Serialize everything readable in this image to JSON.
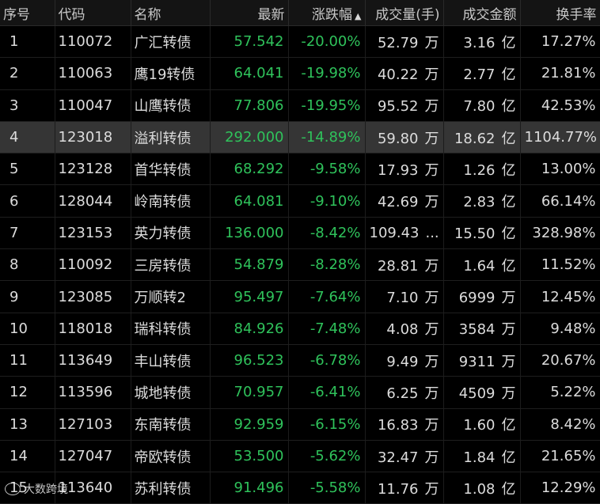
{
  "table": {
    "headers": {
      "idx": "序号",
      "code": "代码",
      "name": "名称",
      "last": "最新",
      "change": "涨跌幅",
      "change_sort_icon": "triangle-up-icon",
      "volume": "成交量(手)",
      "amount": "成交金额",
      "turnover": "换手率"
    },
    "selected_row": 4,
    "colors": {
      "down": "#2fc25b",
      "text": "#dcdcdc",
      "selected_bg": "#353535",
      "background": "#000000"
    },
    "rows": [
      {
        "idx": "1",
        "code": "110072",
        "name": "广汇转债",
        "last": "57.542",
        "change": "-20.00%",
        "volume": "52.79",
        "volume_unit": "万",
        "amount": "3.16",
        "amount_unit": "亿",
        "turnover": "17.27%"
      },
      {
        "idx": "2",
        "code": "110063",
        "name": "鹰19转债",
        "last": "64.041",
        "change": "-19.98%",
        "volume": "40.22",
        "volume_unit": "万",
        "amount": "2.77",
        "amount_unit": "亿",
        "turnover": "21.81%"
      },
      {
        "idx": "3",
        "code": "110047",
        "name": "山鹰转债",
        "last": "77.806",
        "change": "-19.95%",
        "volume": "95.52",
        "volume_unit": "万",
        "amount": "7.80",
        "amount_unit": "亿",
        "turnover": "42.53%"
      },
      {
        "idx": "4",
        "code": "123018",
        "name": "溢利转债",
        "last": "292.000",
        "change": "-14.89%",
        "volume": "59.80",
        "volume_unit": "万",
        "amount": "18.62",
        "amount_unit": "亿",
        "turnover": "1104.77%"
      },
      {
        "idx": "5",
        "code": "123128",
        "name": "首华转债",
        "last": "68.292",
        "change": "-9.58%",
        "volume": "17.93",
        "volume_unit": "万",
        "amount": "1.26",
        "amount_unit": "亿",
        "turnover": "13.00%"
      },
      {
        "idx": "6",
        "code": "128044",
        "name": "岭南转债",
        "last": "64.081",
        "change": "-9.10%",
        "volume": "42.69",
        "volume_unit": "万",
        "amount": "2.83",
        "amount_unit": "亿",
        "turnover": "66.14%"
      },
      {
        "idx": "7",
        "code": "123153",
        "name": "英力转债",
        "last": "136.000",
        "change": "-8.42%",
        "volume": "109.43",
        "volume_unit": "...",
        "amount": "15.50",
        "amount_unit": "亿",
        "turnover": "328.98%"
      },
      {
        "idx": "8",
        "code": "110092",
        "name": "三房转债",
        "last": "54.879",
        "change": "-8.28%",
        "volume": "28.81",
        "volume_unit": "万",
        "amount": "1.64",
        "amount_unit": "亿",
        "turnover": "11.52%"
      },
      {
        "idx": "9",
        "code": "123085",
        "name": "万顺转2",
        "last": "95.497",
        "change": "-7.64%",
        "volume": "7.10",
        "volume_unit": "万",
        "amount": "6999",
        "amount_unit": "万",
        "turnover": "12.45%"
      },
      {
        "idx": "10",
        "code": "118018",
        "name": "瑞科转债",
        "last": "84.926",
        "change": "-7.48%",
        "volume": "4.08",
        "volume_unit": "万",
        "amount": "3584",
        "amount_unit": "万",
        "turnover": "9.48%"
      },
      {
        "idx": "11",
        "code": "113649",
        "name": "丰山转债",
        "last": "96.523",
        "change": "-6.78%",
        "volume": "9.49",
        "volume_unit": "万",
        "amount": "9311",
        "amount_unit": "万",
        "turnover": "20.67%"
      },
      {
        "idx": "12",
        "code": "113596",
        "name": "城地转债",
        "last": "70.957",
        "change": "-6.41%",
        "volume": "6.25",
        "volume_unit": "万",
        "amount": "4509",
        "amount_unit": "万",
        "turnover": "5.22%"
      },
      {
        "idx": "13",
        "code": "127103",
        "name": "东南转债",
        "last": "92.959",
        "change": "-6.15%",
        "volume": "16.83",
        "volume_unit": "万",
        "amount": "1.60",
        "amount_unit": "亿",
        "turnover": "8.42%"
      },
      {
        "idx": "14",
        "code": "127047",
        "name": "帝欧转债",
        "last": "53.500",
        "change": "-5.62%",
        "volume": "32.47",
        "volume_unit": "万",
        "amount": "1.84",
        "amount_unit": "亿",
        "turnover": "21.65%"
      },
      {
        "idx": "15",
        "code": "113640",
        "name": "苏利转债",
        "last": "91.496",
        "change": "-5.58%",
        "volume": "11.76",
        "volume_unit": "万",
        "amount": "1.08",
        "amount_unit": "亿",
        "turnover": "12.29%"
      }
    ]
  },
  "watermark": {
    "text": "大数跨境",
    "logo_icon": "watermark-logo-icon"
  }
}
